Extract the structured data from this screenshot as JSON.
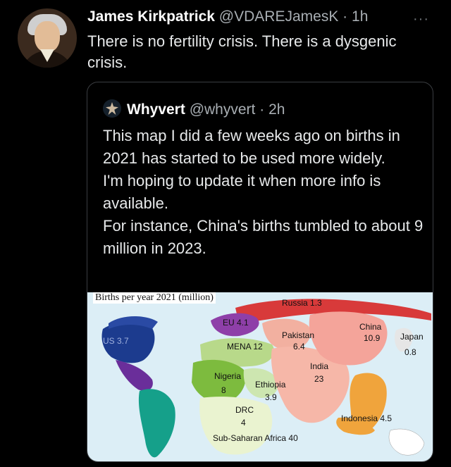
{
  "tweet": {
    "author_name": "James Kirkpatrick",
    "author_handle": "@VDAREJamesK",
    "separator": "·",
    "time": "1h",
    "more": "···",
    "text": "There is no fertility crisis. There is a dysgenic crisis."
  },
  "quote": {
    "author_name": "Whyvert",
    "author_handle": "@whyvert",
    "separator": "·",
    "time": "2h",
    "paragraphs": [
      "This map I did a few weeks ago on births in 2021 has started to be used more widely.",
      "I'm hoping to update it when more info is available.",
      "For instance, China's births tumbled to about 9 million in 2023."
    ]
  },
  "map": {
    "title": "Births per year 2021 (million)",
    "labels": {
      "russia": "Russia 1.3",
      "eu": "EU 4.1",
      "us": "US 3.7",
      "pakistan": "Pakistan",
      "pakistan_value": "6.4",
      "china": "China",
      "china_value": "10.9",
      "japan": "Japan",
      "japan_value": "0.8",
      "mena": "MENA 12",
      "india": "India",
      "india_value": "23",
      "nigeria": "Nigeria",
      "nigeria_value": "8",
      "ethiopia": "Ethiopia",
      "ethiopia_value": "3.9",
      "drc": "DRC",
      "drc_value": "4",
      "indonesia": "Indonesia 4.5",
      "ssa": "Sub-Saharan Africa 40"
    }
  }
}
